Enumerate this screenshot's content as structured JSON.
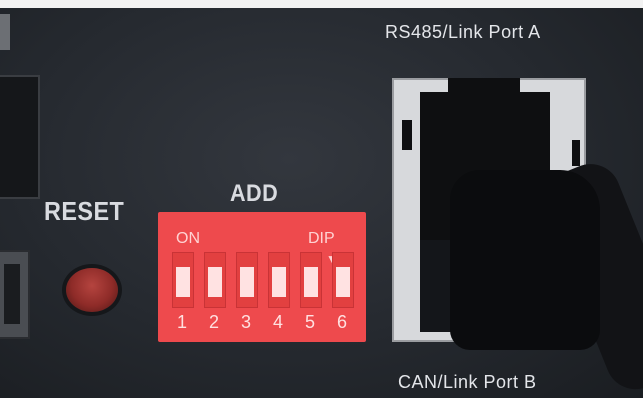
{
  "labels": {
    "reset": "RESET",
    "add": "ADD",
    "port_a": "RS485/Link Port A",
    "port_b": "CAN/Link Port B"
  },
  "dip_switch": {
    "on_text": "ON",
    "dip_text": "DIP",
    "numbers": [
      "1",
      "2",
      "3",
      "4",
      "5",
      "6"
    ]
  },
  "colors": {
    "panel": "#2b2f35",
    "dip_body": "#ee4a4d",
    "reset_button": "#9c3431",
    "port_housing": "#d7d9dc"
  }
}
